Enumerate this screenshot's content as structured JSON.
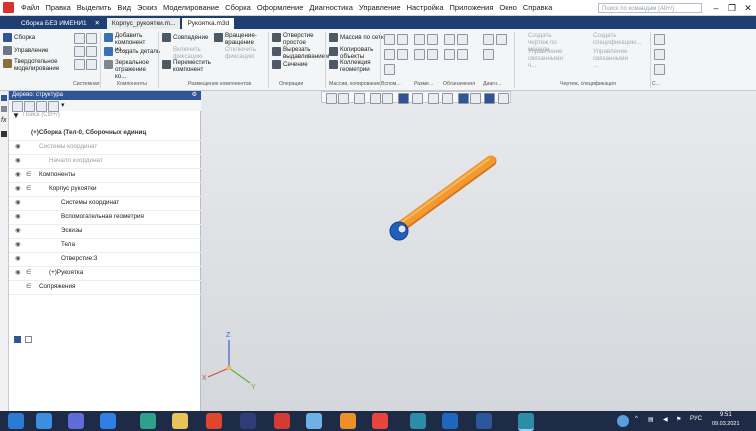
{
  "menu": {
    "items": [
      "Файл",
      "Правка",
      "Выделить",
      "Вид",
      "Эскиз",
      "Моделирование",
      "Сборка",
      "Оформление",
      "Диагностика",
      "Управление",
      "Настройка",
      "Приложения",
      "Окно",
      "Справка"
    ],
    "search_placeholder": "Поиск по командам (Alt+/)"
  },
  "tabs": [
    {
      "label": "Сборка БЕЗ ИМЕНИ1"
    },
    {
      "label": "Корпус_рукоятки.m..."
    },
    {
      "label": "Рукоятка.m3d"
    }
  ],
  "ribbon": {
    "left_items": [
      "Сборка",
      "Управление",
      "Твердотельное моделирование"
    ],
    "btn_add_component": "Добавить компонент из...",
    "btn_create_part": "Создать деталь",
    "btn_mirror": "Зеркальное отражение ко...",
    "btn_coincidence": "Совпадение",
    "btn_disable_fixing": "Включить фиксацию",
    "btn_rotation": "Вращение-вращение",
    "btn_fixing_off": "Отключить фиксацию",
    "btn_move": "Переместить компонент",
    "btn_hole": "Отверстие простое",
    "btn_cut": "Вырезать выдавливанием",
    "btn_section": "Сечение",
    "btn_array": "Массив по сетке",
    "btn_copy": "Копировать объекты",
    "btn_collection": "Коллекция геометрии",
    "btn_create_drawing": "Создать чертеж по модели",
    "btn_create_spec": "Создать спецификацию...",
    "btn_manage1": "Управление связанными ч...",
    "btn_manage2": "Управление связанными ...",
    "groups": [
      "Системная",
      "Компоненты",
      "Размещение компонентов",
      "Операции",
      "Массив, копирование",
      "Вспом...",
      "Разме...",
      "Обозначения",
      "Диагн...",
      "Чертеж, спецификация",
      "С..."
    ]
  },
  "tree": {
    "title": "Дерево: структура",
    "search_placeholder": "Поиск (Ctrl+/)",
    "rows": [
      {
        "text": "(+)Сборка (Тел-0, Сборочных единиц"
      },
      {
        "text": "Системы координат"
      },
      {
        "text": "Начало координат"
      },
      {
        "text": "Компоненты"
      },
      {
        "text": "Корпус рукоятки"
      },
      {
        "text": "Системы координат"
      },
      {
        "text": "Вспомогательная геометрия"
      },
      {
        "text": "Эскизы"
      },
      {
        "text": "Тела"
      },
      {
        "text": "Отверстие:3"
      },
      {
        "text": "(+)Рукоятка"
      },
      {
        "text": "Сопряжения"
      }
    ]
  },
  "viewport": {
    "axis_labels": {
      "x": "X",
      "y": "Y",
      "z": "Z"
    }
  },
  "taskbar": {
    "lang": "РУС",
    "time": "9:51",
    "date": "09.03.2021"
  },
  "colors": {
    "accent": "#2f5597",
    "taskbar": "#1d2b46",
    "handle": "#f29a2e",
    "ball": "#1f5fbf"
  }
}
